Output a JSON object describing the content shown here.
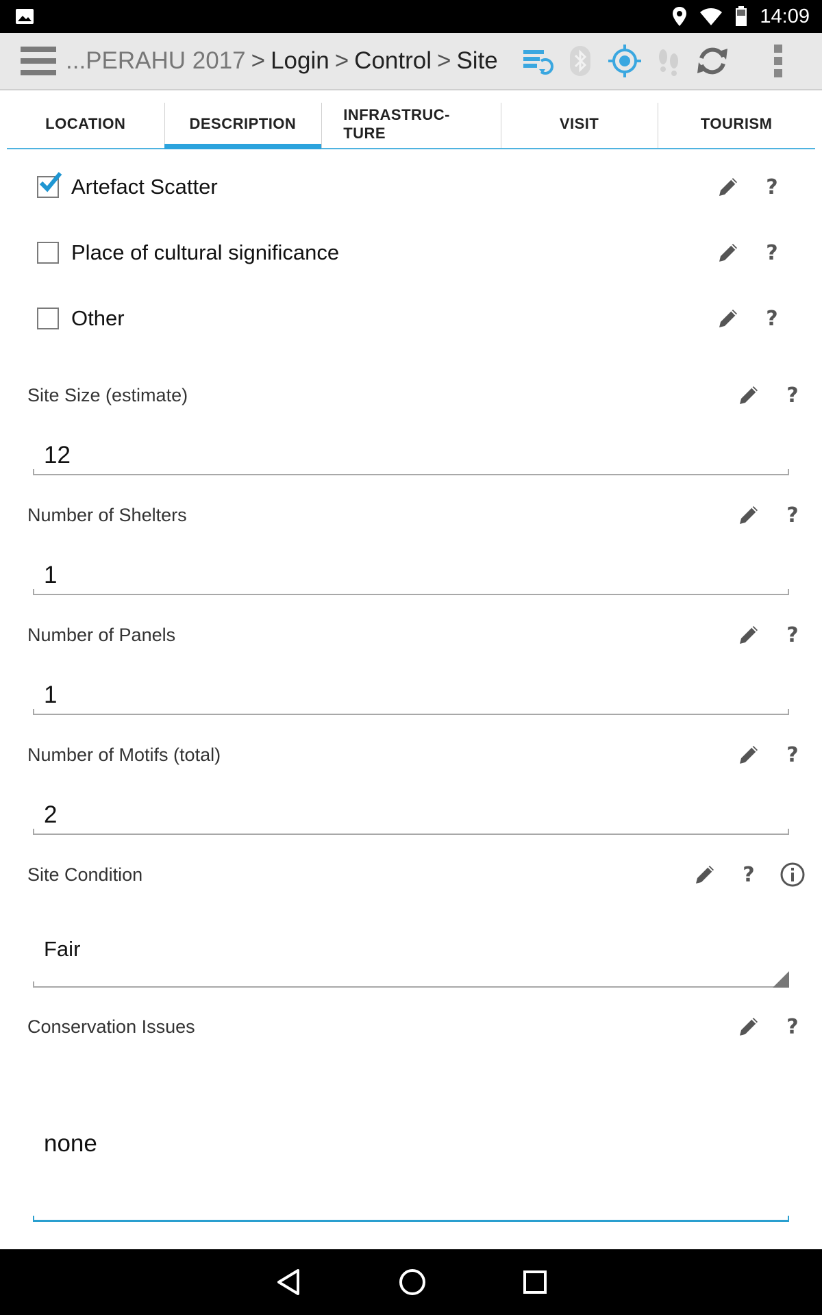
{
  "status_bar": {
    "time": "14:09"
  },
  "breadcrumb": {
    "project": "...PERAHU 2017",
    "sep1": ">",
    "login": "Login",
    "sep2": ">",
    "control": "Control",
    "sep3": ">",
    "site": "Site"
  },
  "tabs": [
    {
      "label": "LOCATION"
    },
    {
      "label": "DESCRIPTION"
    },
    {
      "label_line1": "INFRASTRUC-",
      "label_line2": "TURE"
    },
    {
      "label": "VISIT"
    },
    {
      "label": "TOURISM"
    }
  ],
  "active_tab": "DESCRIPTION",
  "checkboxes": [
    {
      "label": "Artefact Scatter",
      "checked": true
    },
    {
      "label": "Place of cultural significance",
      "checked": false
    },
    {
      "label": "Other",
      "checked": false
    }
  ],
  "fields": {
    "site_size": {
      "label": "Site Size (estimate)",
      "value": "12"
    },
    "shelters": {
      "label": "Number of Shelters",
      "value": "1"
    },
    "panels": {
      "label": "Number of Panels",
      "value": "1"
    },
    "motifs": {
      "label": "Number of Motifs (total)",
      "value": "2"
    },
    "condition": {
      "label": "Site Condition",
      "value": "Fair"
    },
    "conservation": {
      "label": "Conservation Issues",
      "value": "none"
    }
  },
  "help_glyph": "?",
  "colors": {
    "accent": "#2ba3dd",
    "action_bar": "#e8e8e8",
    "icon_gray": "#555555"
  },
  "icons": [
    "menu-icon",
    "sync-icon",
    "bluetooth-icon",
    "gps-icon",
    "footsteps-icon",
    "refresh-icon",
    "overflow-icon",
    "edit-icon",
    "help-icon",
    "info-icon"
  ]
}
